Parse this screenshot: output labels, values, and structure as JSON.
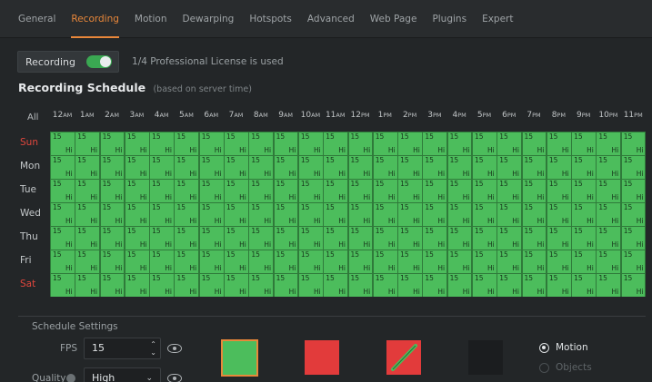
{
  "tabs": [
    {
      "label": "General",
      "active": false
    },
    {
      "label": "Recording",
      "active": true
    },
    {
      "label": "Motion",
      "active": false
    },
    {
      "label": "Dewarping",
      "active": false
    },
    {
      "label": "Hotspots",
      "active": false
    },
    {
      "label": "Advanced",
      "active": false
    },
    {
      "label": "Web Page",
      "active": false
    },
    {
      "label": "Plugins",
      "active": false
    },
    {
      "label": "Expert",
      "active": false
    }
  ],
  "recording": {
    "label": "Recording",
    "enabled": true,
    "license_text": "1/4 Professional License is used"
  },
  "schedule": {
    "title": "Recording Schedule",
    "subtitle": "(based on server time)",
    "all_label": "All",
    "hours": [
      {
        "num": "12",
        "ap": "AM"
      },
      {
        "num": "1",
        "ap": "AM"
      },
      {
        "num": "2",
        "ap": "AM"
      },
      {
        "num": "3",
        "ap": "AM"
      },
      {
        "num": "4",
        "ap": "AM"
      },
      {
        "num": "5",
        "ap": "AM"
      },
      {
        "num": "6",
        "ap": "AM"
      },
      {
        "num": "7",
        "ap": "AM"
      },
      {
        "num": "8",
        "ap": "AM"
      },
      {
        "num": "9",
        "ap": "AM"
      },
      {
        "num": "10",
        "ap": "AM"
      },
      {
        "num": "11",
        "ap": "AM"
      },
      {
        "num": "12",
        "ap": "PM"
      },
      {
        "num": "1",
        "ap": "PM"
      },
      {
        "num": "2",
        "ap": "PM"
      },
      {
        "num": "3",
        "ap": "PM"
      },
      {
        "num": "4",
        "ap": "PM"
      },
      {
        "num": "5",
        "ap": "PM"
      },
      {
        "num": "6",
        "ap": "PM"
      },
      {
        "num": "7",
        "ap": "PM"
      },
      {
        "num": "8",
        "ap": "PM"
      },
      {
        "num": "9",
        "ap": "PM"
      },
      {
        "num": "10",
        "ap": "PM"
      },
      {
        "num": "11",
        "ap": "PM"
      }
    ],
    "days": [
      {
        "label": "Sun",
        "weekend": true
      },
      {
        "label": "Mon",
        "weekend": false
      },
      {
        "label": "Tue",
        "weekend": false
      },
      {
        "label": "Wed",
        "weekend": false
      },
      {
        "label": "Thu",
        "weekend": false
      },
      {
        "label": "Fri",
        "weekend": false
      },
      {
        "label": "Sat",
        "weekend": true
      }
    ],
    "cell_fps": "15",
    "cell_quality": "Hi"
  },
  "settings": {
    "title": "Schedule Settings",
    "fps_label": "FPS",
    "fps_value": "15",
    "quality_label": "Quality",
    "quality_value": "High",
    "radio_motion": "Motion",
    "radio_objects": "Objects"
  },
  "colors": {
    "accent": "#e8873a",
    "record_green": "#4cbd5c",
    "weekend_red": "#e0463d",
    "brush_red": "#e23b3b"
  },
  "icons": {
    "spin": "up-down-chevron-icon",
    "eye": "eye-icon",
    "chevron": "chevron-down-icon",
    "pencil": "pencil-icon"
  }
}
